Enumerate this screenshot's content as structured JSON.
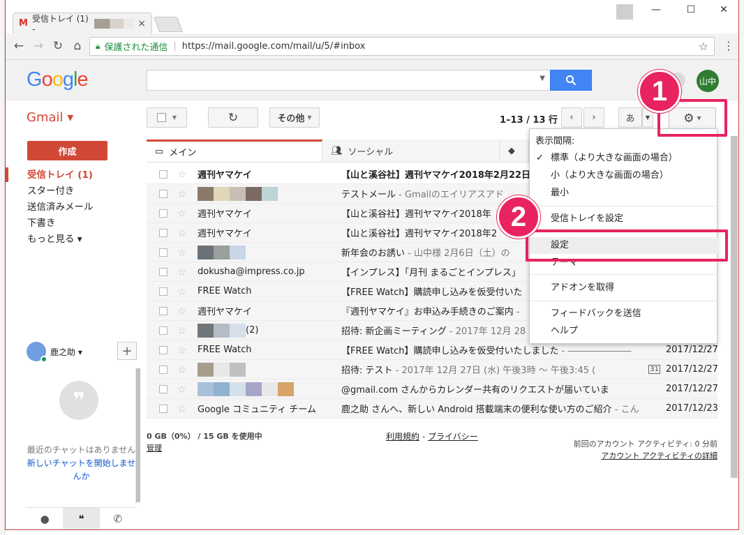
{
  "browser": {
    "tab_title": "受信トレイ (1) -",
    "tab_icon": "M",
    "tab_close": "×",
    "secure_label": "保護された通信",
    "url": "https://mail.google.com/mail/u/5/#inbox",
    "window_controls": [
      "—",
      "☐",
      "✕"
    ]
  },
  "header": {
    "logo_letters": [
      "G",
      "o",
      "o",
      "g",
      "l",
      "e"
    ],
    "logo_colors": [
      "#4285f4",
      "#ea4335",
      "#fbbc05",
      "#4285f4",
      "#34a853",
      "#ea4335"
    ],
    "avatar_text": "山中",
    "search_value": ""
  },
  "toolbar": {
    "gmail_label": "Gmail ▾",
    "more_label": "その他",
    "pager": "1–13 / 13 行",
    "input_tool": "あ"
  },
  "nav": {
    "compose_label": "作成",
    "items": [
      "受信トレイ (1)",
      "スター付き",
      "送信済みメール",
      "下書き",
      "もっと見る ▾"
    ]
  },
  "chat": {
    "user_name": "鹿之助 ▾",
    "empty_text": "最近のチャットはありません",
    "start_link": "新しいチャットを開始しませんか"
  },
  "tabs": {
    "main": "メイン",
    "social": "ソーシャル"
  },
  "mail_rows": [
    {
      "sender": "週刊ヤマケイ",
      "subject": "【山と溪谷社】週刊ヤマケイ2018年2月22日",
      "snippet": "",
      "date": "",
      "unread": true
    },
    {
      "sender": "",
      "subject": "テストメール",
      "snippet": " - Gmailのエイリアスアド",
      "date": "",
      "unread": false,
      "blur": [
        "#8a7a68",
        "#e0d7b9",
        "#c8bfb2",
        "#7b6a62",
        "#bcd5d6"
      ]
    },
    {
      "sender": "週刊ヤマケイ",
      "subject": "【山と溪谷社】週刊ヤマケイ2018年",
      "snippet": "",
      "date": "",
      "unread": false
    },
    {
      "sender": "週刊ヤマケイ",
      "subject": "【山と溪谷社】週刊ヤマケイ2018年2",
      "snippet": "",
      "date": "",
      "unread": false
    },
    {
      "sender": "",
      "subject": "新年会のお誘い",
      "snippet": " - 山中様 2月6日（土）の",
      "date": "",
      "unread": false,
      "blur": [
        "#6a7278",
        "#9a9e9c",
        "#c8d6e5"
      ]
    },
    {
      "sender": "dokusha@impress.co.jp",
      "subject": "【インプレス】「月刊 まるごとインプレス」",
      "snippet": "",
      "date": "",
      "unread": false
    },
    {
      "sender": "FREE Watch",
      "subject": "【FREE Watch】購読申し込みを仮受付いた",
      "snippet": "",
      "date": "",
      "unread": false
    },
    {
      "sender": "週刊ヤマケイ",
      "subject": "『週刊ヤマケイ』お申込み手続きのご案内",
      "snippet": " - ",
      "date": "",
      "unread": false
    },
    {
      "sender": "(2)",
      "subject": "招待: 新企画ミーティング",
      "snippet": " - 2017年 12月 28",
      "date": "",
      "unread": false,
      "blur": [
        "#70767a",
        "#b6bcc6",
        "#d4dfea"
      ]
    },
    {
      "sender": "FREE Watch",
      "subject": "【FREE Watch】購読申し込みを仮受付いたしました",
      "snippet": " - ―――――――",
      "date": "2017/12/27",
      "unread": false
    },
    {
      "sender": "",
      "subject": "招待: テスト",
      "snippet": " - 2017年 12月 27日 (水) 午後3時 ～ 午後3:45 (",
      "date": "2017/12/27",
      "unread": false,
      "blur": [
        "#a69e8c",
        "#e8e8e8",
        "#c1c1c1"
      ],
      "calendar": "31"
    },
    {
      "sender": "",
      "subject": "@gmail.com さんからカレンダー共有のリクエストが届いていま",
      "snippet": "",
      "date": "2017/12/27",
      "unread": false,
      "blur": [
        "#a8c1d9",
        "#8fb2cf",
        "#d5e1ea",
        "#a7a5c9",
        "#e8e8e8",
        "#d6a36a"
      ]
    },
    {
      "sender": "Google コミュニティ チーム",
      "subject": "鹿之助 さんへ、新しい Android 搭載端末の便利な使い方のご紹介",
      "snippet": " - こん",
      "date": "2017/12/23",
      "unread": false
    }
  ],
  "footer": {
    "storage": "0 GB（0%） / 15 GB を使用中",
    "manage": "管理",
    "terms": "利用規約",
    "dash": " - ",
    "privacy": "プライバシー",
    "activity": "前回のアカウント アクティビティ: 0 分前",
    "activity_link": "アカウント アクティビティの詳細"
  },
  "settings_menu": {
    "header": "表示間隔:",
    "density": [
      "標準（より大きな画面の場合）",
      "小（より大きな画面の場合）",
      "最小"
    ],
    "checked_mark": "✓",
    "configure_inbox": "受信トレイを設定",
    "settings": "設定",
    "themes": "テーマ",
    "addons": "アドオンを取得",
    "feedback": "フィードバックを送信",
    "help": "ヘルプ"
  },
  "annotations": {
    "step1": "1",
    "step2": "2",
    "highlight_color": "#e8235f"
  }
}
